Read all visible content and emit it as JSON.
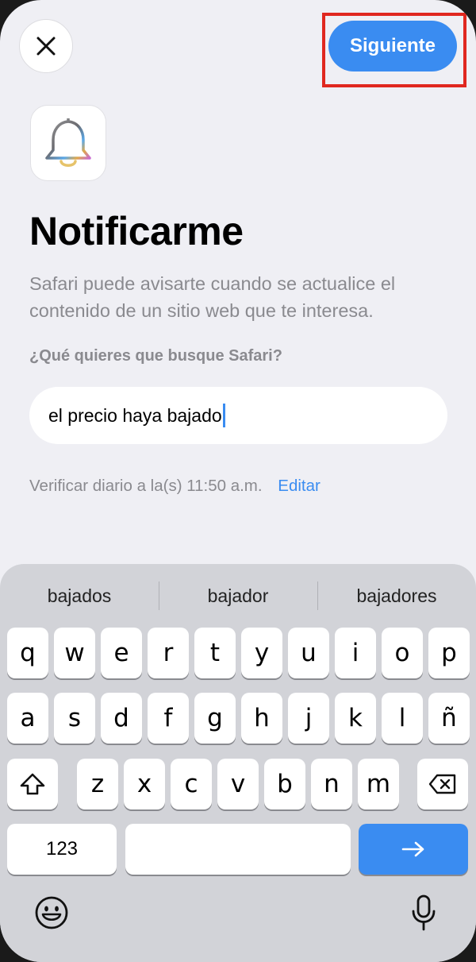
{
  "header": {
    "close_icon": "close-icon",
    "next_label": "Siguiente"
  },
  "app_icon": "bell-icon",
  "title": "Notificarme",
  "description": "Safari puede avisarte cuando se actualice el contenido de un sitio web que te interesa.",
  "question": "¿Qué quieres que busque Safari?",
  "input": {
    "value": "el precio haya bajado"
  },
  "schedule": {
    "text": "Verificar diario a la(s) 11:50 a.m.",
    "edit_label": "Editar"
  },
  "keyboard": {
    "suggestions": [
      "bajados",
      "bajador",
      "bajadores"
    ],
    "row1": [
      "q",
      "w",
      "e",
      "r",
      "t",
      "y",
      "u",
      "i",
      "o",
      "p"
    ],
    "row2": [
      "a",
      "s",
      "d",
      "f",
      "g",
      "h",
      "j",
      "k",
      "l",
      "ñ"
    ],
    "row3": [
      "z",
      "x",
      "c",
      "v",
      "b",
      "n",
      "m"
    ],
    "numbers_label": "123",
    "shift_icon": "shift-icon",
    "backspace_icon": "backspace-icon",
    "go_icon": "arrow-right-icon",
    "emoji_icon": "emoji-icon",
    "mic_icon": "microphone-icon"
  },
  "colors": {
    "accent": "#3a8cf1",
    "highlight": "#e0271f",
    "background": "#efeff4"
  }
}
